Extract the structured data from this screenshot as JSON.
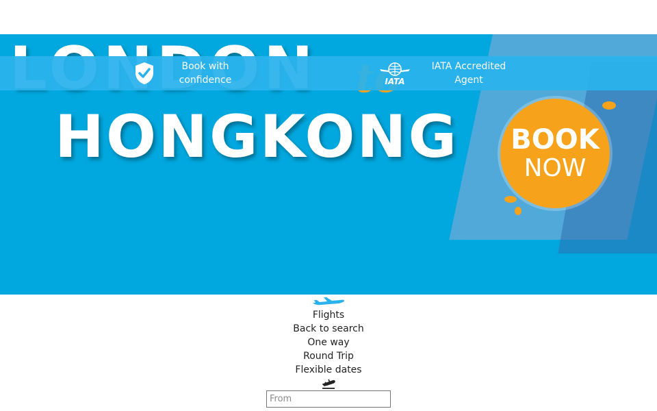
{
  "hero": {
    "line1": "LONDON",
    "connector": "to",
    "line2": "HONGKONG",
    "badge_line1": "BOOK",
    "badge_line2": "NOW"
  },
  "trust_bar": {
    "item1": "Book with confidence",
    "item2": "IATA Accredited Agent",
    "iata_logo_text": "IATA"
  },
  "search": {
    "tab_label": "Flights",
    "back_link": "Back to search",
    "trip_options": [
      "One way",
      "Round Trip",
      "Flexible dates"
    ],
    "from_placeholder": "From"
  },
  "colors": {
    "hero_bg": "#00a8df",
    "trust_bar_bg": "#2ab2ec",
    "accent_orange": "#f7a21b",
    "plane_icon": "#2ab2ec"
  },
  "icons": [
    "shield-check-icon",
    "iata-logo",
    "airplane-icon",
    "takeoff-icon"
  ]
}
